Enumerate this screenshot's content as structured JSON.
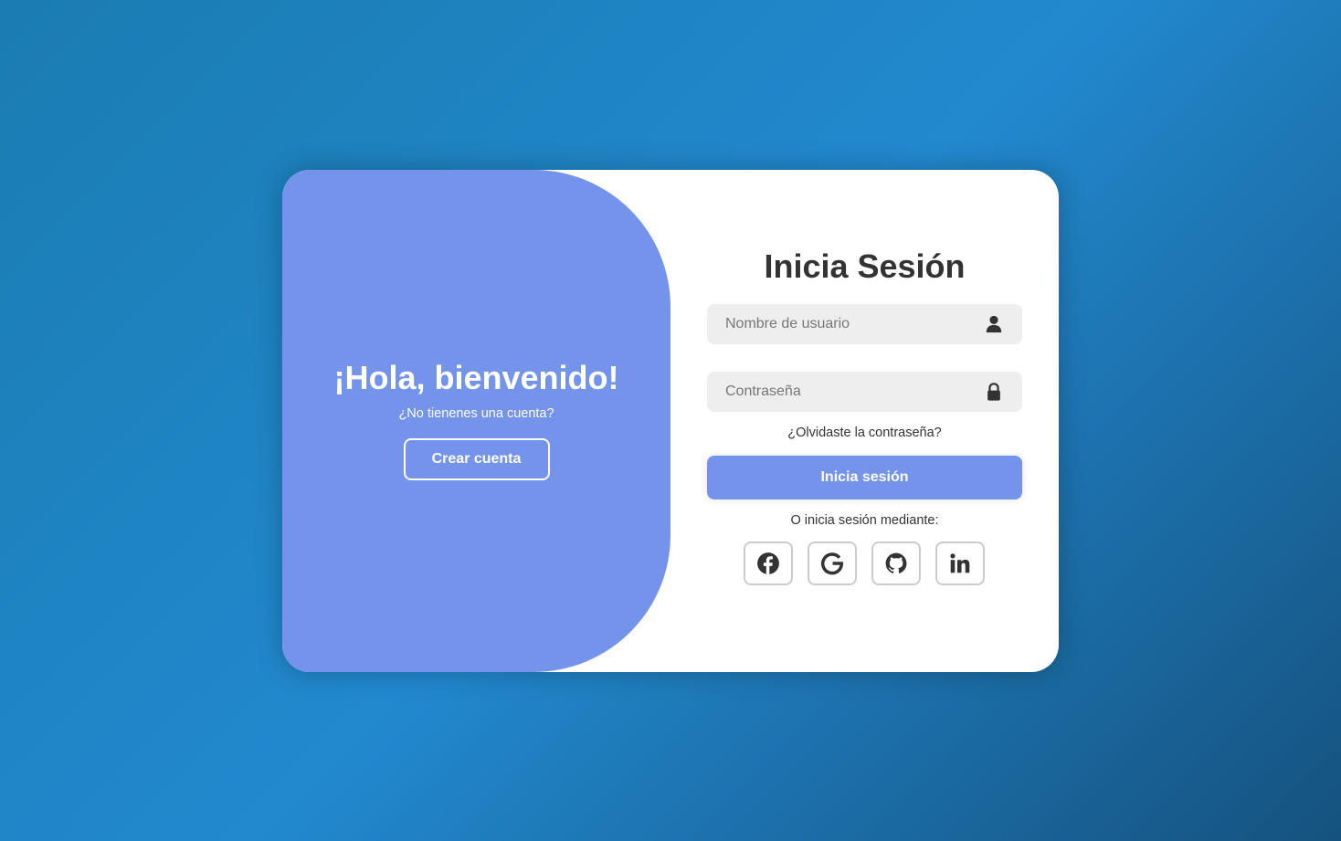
{
  "welcome": {
    "title": "¡Hola, bienvenido!",
    "subtitle": "¿No tienenes una cuenta?",
    "create_account_label": "Crear cuenta"
  },
  "login": {
    "title": "Inicia Sesión",
    "username_placeholder": "Nombre de usuario",
    "username_icon": "user-icon",
    "password_placeholder": "Contraseña",
    "password_icon": "lock-icon",
    "forgot_password": "¿Olvidaste la contraseña?",
    "submit_label": "Inicia sesión",
    "alt_login_text": "O inicia sesión mediante:",
    "social": [
      {
        "icon": "facebook-icon"
      },
      {
        "icon": "google-icon"
      },
      {
        "icon": "github-icon"
      },
      {
        "icon": "linkedin-icon"
      }
    ]
  },
  "colors": {
    "accent": "#7494ec",
    "card": "#ffffff",
    "input_bg": "#eeeeee",
    "text": "#333333",
    "background_start": "#1a7cb1",
    "background_end": "#15527f"
  }
}
